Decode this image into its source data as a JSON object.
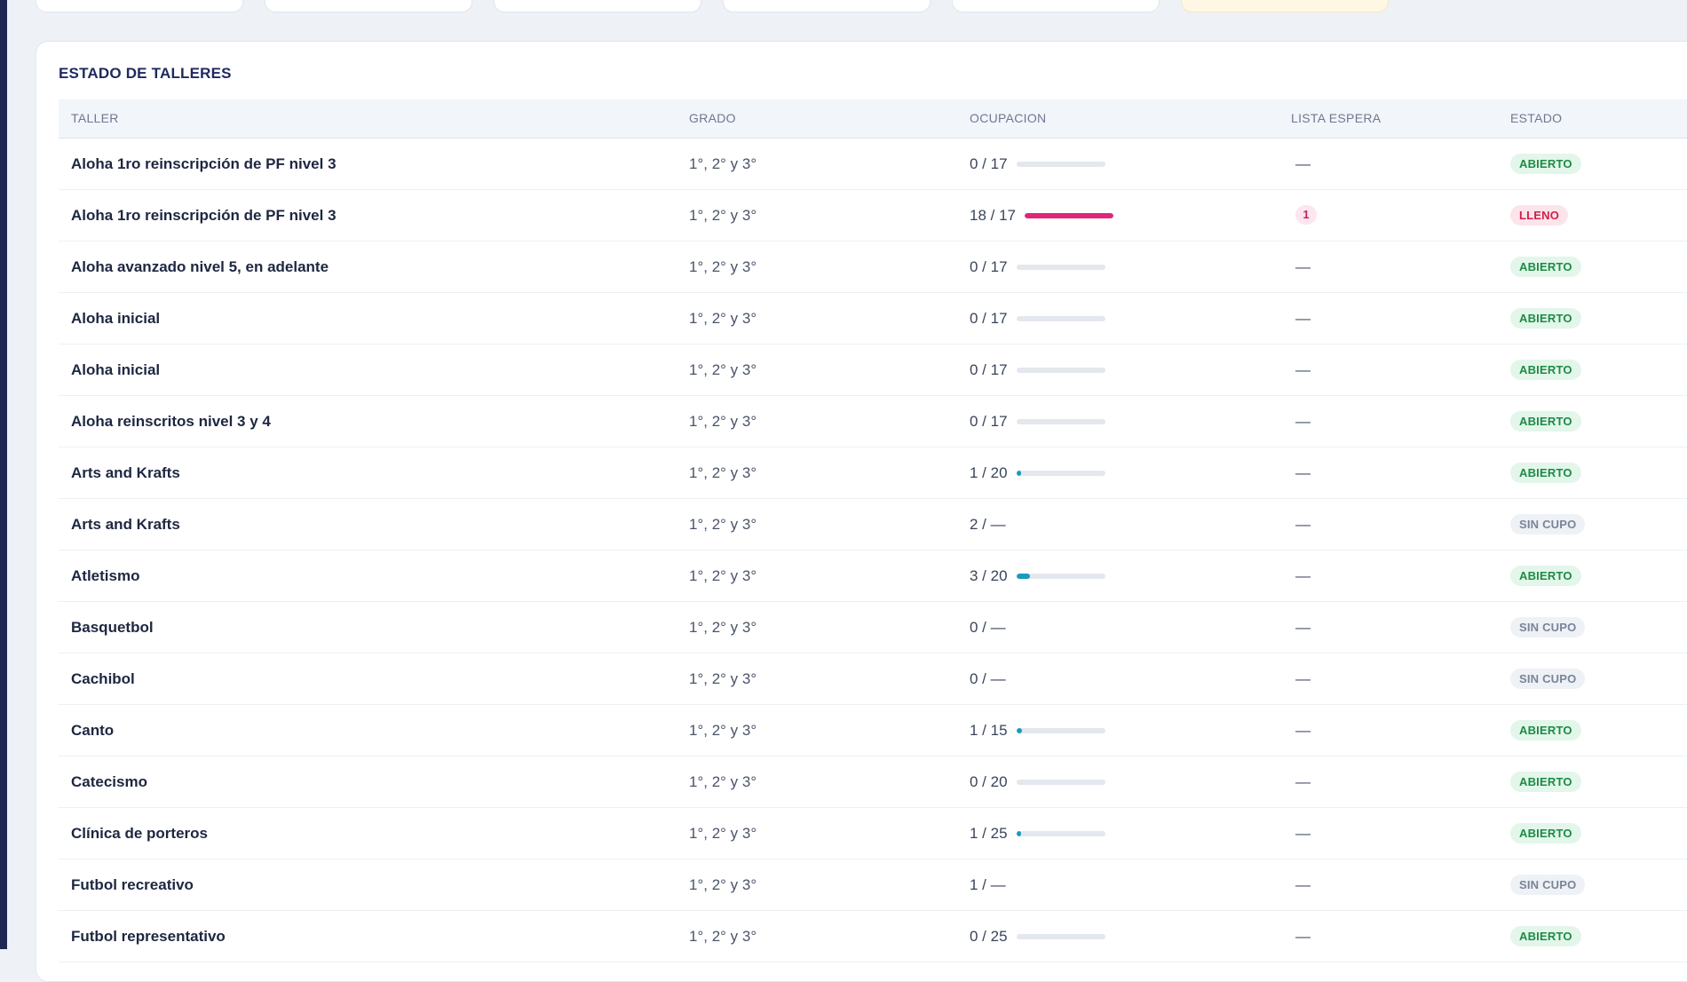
{
  "panel": {
    "title": "ESTADO DE TALLERES"
  },
  "table": {
    "columns": [
      "TALLER",
      "GRADO",
      "OCUPACION",
      "LISTA ESPERA",
      "ESTADO"
    ],
    "rows": [
      {
        "taller": "Aloha 1ro reinscripción de PF nivel 3",
        "grado": "1°, 2° y 3°",
        "ocupacion": "0 / 17",
        "fill": 0,
        "lista_espera": "—",
        "estado": "ABIERTO"
      },
      {
        "taller": "Aloha 1ro reinscripción de PF nivel 3",
        "grado": "1°, 2° y 3°",
        "ocupacion": "18 / 17",
        "fill": 1,
        "lista_espera": "1",
        "estado": "LLENO"
      },
      {
        "taller": "Aloha avanzado nivel 5, en adelante",
        "grado": "1°, 2° y 3°",
        "ocupacion": "0 / 17",
        "fill": 0,
        "lista_espera": "—",
        "estado": "ABIERTO"
      },
      {
        "taller": "Aloha inicial",
        "grado": "1°, 2° y 3°",
        "ocupacion": "0 / 17",
        "fill": 0,
        "lista_espera": "—",
        "estado": "ABIERTO"
      },
      {
        "taller": "Aloha inicial",
        "grado": "1°, 2° y 3°",
        "ocupacion": "0 / 17",
        "fill": 0,
        "lista_espera": "—",
        "estado": "ABIERTO"
      },
      {
        "taller": "Aloha reinscritos nivel 3 y 4",
        "grado": "1°, 2° y 3°",
        "ocupacion": "0 / 17",
        "fill": 0,
        "lista_espera": "—",
        "estado": "ABIERTO"
      },
      {
        "taller": "Arts and Krafts",
        "grado": "1°, 2° y 3°",
        "ocupacion": "1 / 20",
        "fill": 0.05,
        "lista_espera": "—",
        "estado": "ABIERTO"
      },
      {
        "taller": "Arts and Krafts",
        "grado": "1°, 2° y 3°",
        "ocupacion": "2 / —",
        "fill": null,
        "lista_espera": "—",
        "estado": "SIN CUPO"
      },
      {
        "taller": "Atletismo",
        "grado": "1°, 2° y 3°",
        "ocupacion": "3 / 20",
        "fill": 0.15,
        "lista_espera": "—",
        "estado": "ABIERTO"
      },
      {
        "taller": "Basquetbol",
        "grado": "1°, 2° y 3°",
        "ocupacion": "0 / —",
        "fill": null,
        "lista_espera": "—",
        "estado": "SIN CUPO"
      },
      {
        "taller": "Cachibol",
        "grado": "1°, 2° y 3°",
        "ocupacion": "0 / —",
        "fill": null,
        "lista_espera": "—",
        "estado": "SIN CUPO"
      },
      {
        "taller": "Canto",
        "grado": "1°, 2° y 3°",
        "ocupacion": "1 / 15",
        "fill": 0.0667,
        "lista_espera": "—",
        "estado": "ABIERTO"
      },
      {
        "taller": "Catecismo",
        "grado": "1°, 2° y 3°",
        "ocupacion": "0 / 20",
        "fill": 0,
        "lista_espera": "—",
        "estado": "ABIERTO"
      },
      {
        "taller": "Clínica de porteros",
        "grado": "1°, 2° y 3°",
        "ocupacion": "1 / 25",
        "fill": 0.04,
        "lista_espera": "—",
        "estado": "ABIERTO"
      },
      {
        "taller": "Futbol recreativo",
        "grado": "1°, 2° y 3°",
        "ocupacion": "1 / —",
        "fill": null,
        "lista_espera": "—",
        "estado": "SIN CUPO"
      },
      {
        "taller": "Futbol representativo",
        "grado": "1°, 2° y 3°",
        "ocupacion": "0 / 25",
        "fill": 0,
        "lista_espera": "—",
        "estado": "ABIERTO"
      }
    ]
  },
  "colors": {
    "fill_normal": "#1a9bbd",
    "fill_full": "#e0267a"
  }
}
